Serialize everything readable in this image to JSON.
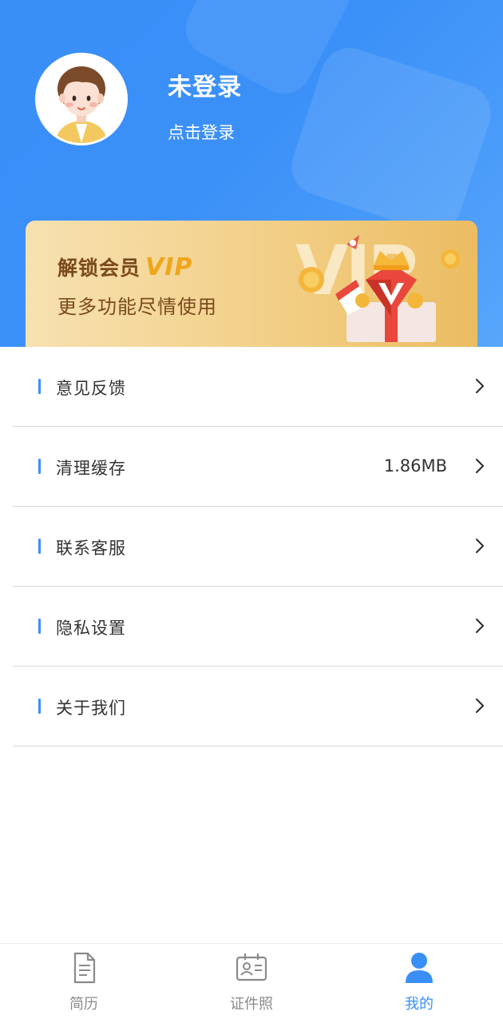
{
  "profile": {
    "title": "未登录",
    "subtitle": "点击登录"
  },
  "vip": {
    "line1": "解锁会员",
    "badge": "VIP",
    "line2": "更多功能尽情使用"
  },
  "menu": [
    {
      "label": "意见反馈",
      "value": ""
    },
    {
      "label": "清理缓存",
      "value": "1.86MB"
    },
    {
      "label": "联系客服",
      "value": ""
    },
    {
      "label": "隐私设置",
      "value": ""
    },
    {
      "label": "关于我们",
      "value": ""
    }
  ],
  "nav": [
    {
      "label": "简历",
      "icon": "document-icon",
      "active": false
    },
    {
      "label": "证件照",
      "icon": "id-card-icon",
      "active": false
    },
    {
      "label": "我的",
      "icon": "user-icon",
      "active": true
    }
  ],
  "colors": {
    "primary": "#3a8ff7",
    "vip_text": "#7a4a1d",
    "vip_badge": "#f0a51c",
    "nav_inactive": "#8a8a8a"
  }
}
